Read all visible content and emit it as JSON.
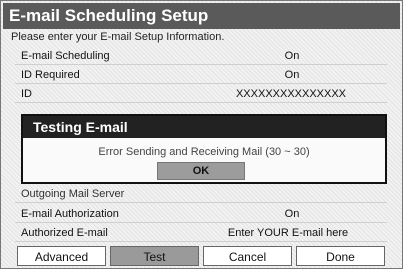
{
  "window": {
    "title": "E-mail Scheduling Setup"
  },
  "prompt": "Please enter your E-mail Setup Information.",
  "rows": {
    "email_scheduling": {
      "label": "E-mail Scheduling",
      "value": "On"
    },
    "id_required": {
      "label": "ID Required",
      "value": "On"
    },
    "id": {
      "label": "ID",
      "value": "XXXXXXXXXXXXXXX"
    },
    "outgoing": {
      "label": "Outgoing Mail Server",
      "value": ""
    },
    "auth": {
      "label": "E-mail Authorization",
      "value": "On"
    },
    "authorized": {
      "label": "Authorized E-mail",
      "value": "Enter YOUR E-mail here"
    }
  },
  "dialog": {
    "title": "Testing E-mail",
    "message": "Error Sending and Receiving Mail (30 ~ 30)",
    "ok_label": "OK"
  },
  "buttons": {
    "advanced": "Advanced",
    "test": "Test",
    "cancel": "Cancel",
    "done": "Done"
  },
  "colors": {
    "titlebar": "#5a5a5a",
    "dialog_titlebar": "#222222",
    "selected_button": "#9a9a9a"
  }
}
